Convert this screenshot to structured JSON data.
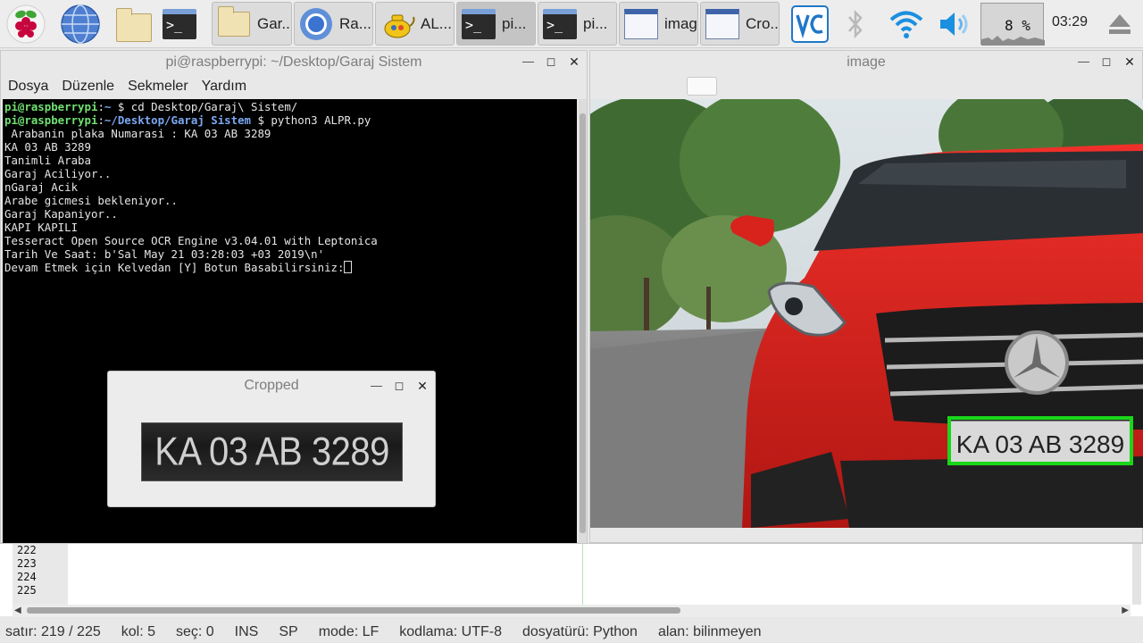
{
  "taskbar": {
    "tasks": [
      {
        "label": "Gar...",
        "icon": "folder-icon"
      },
      {
        "label": "Ra...",
        "icon": "chromium-icon"
      },
      {
        "label": "AL...",
        "icon": "python-teapot-icon"
      },
      {
        "label": "pi...",
        "icon": "terminal-icon",
        "active": true
      },
      {
        "label": "pi...",
        "icon": "terminal-icon"
      },
      {
        "label": "image",
        "icon": "window-icon"
      },
      {
        "label": "Cro...",
        "icon": "window-icon"
      }
    ],
    "cpu": "8 %",
    "clock": "03:29"
  },
  "terminal": {
    "title": "pi@raspberrypi: ~/Desktop/Garaj Sistem",
    "menu": [
      "Dosya",
      "Düzenle",
      "Sekmeler",
      "Yardım"
    ],
    "prompt1": {
      "user": "pi@raspberrypi",
      "sep": ":",
      "path": "~",
      "sym": " $ ",
      "cmd": "cd Desktop/Garaj\\ Sistem/"
    },
    "prompt2": {
      "user": "pi@raspberrypi",
      "sep": ":",
      "path": "~/Desktop/Garaj Sistem",
      "sym": " $ ",
      "cmd": "python3 ALPR.py"
    },
    "output": [
      " Arabanin plaka Numarasi : KA 03 AB 3289",
      "KA 03 AB 3289",
      "Tanimli Araba",
      "Garaj Aciliyor..",
      "nGaraj Acik",
      "Arabe gicmesi bekleniyor..",
      "Garaj Kapaniyor..",
      "KAPI KAPILI",
      "Tesseract Open Source OCR Engine v3.04.01 with Leptonica",
      "Tarih Ve Saat: b'Sal May 21 03:28:03 +03 2019\\n'",
      "Devam Etmek için Kelvedan [Y] Botun Basabilirsiniz:"
    ]
  },
  "image_window": {
    "title": "image",
    "plate_text": "KA 03 AB 3289"
  },
  "cropped_window": {
    "title": "Cropped",
    "plate_text": "KA 03 AB 3289"
  },
  "editor": {
    "line_numbers": [
      "222",
      "223",
      "224",
      "225"
    ]
  },
  "statusbar": {
    "items": [
      "satır: 219 / 225",
      "kol: 5",
      "seç: 0",
      "INS",
      "SP",
      "mode: LF",
      "kodlama: UTF-8",
      "dosyatürü: Python",
      "alan: bilinmeyen"
    ]
  },
  "colors": {
    "prompt_user": "#72e072",
    "prompt_path": "#7ba8f0",
    "car_red": "#e0241f",
    "plate_box": "#19d619"
  }
}
